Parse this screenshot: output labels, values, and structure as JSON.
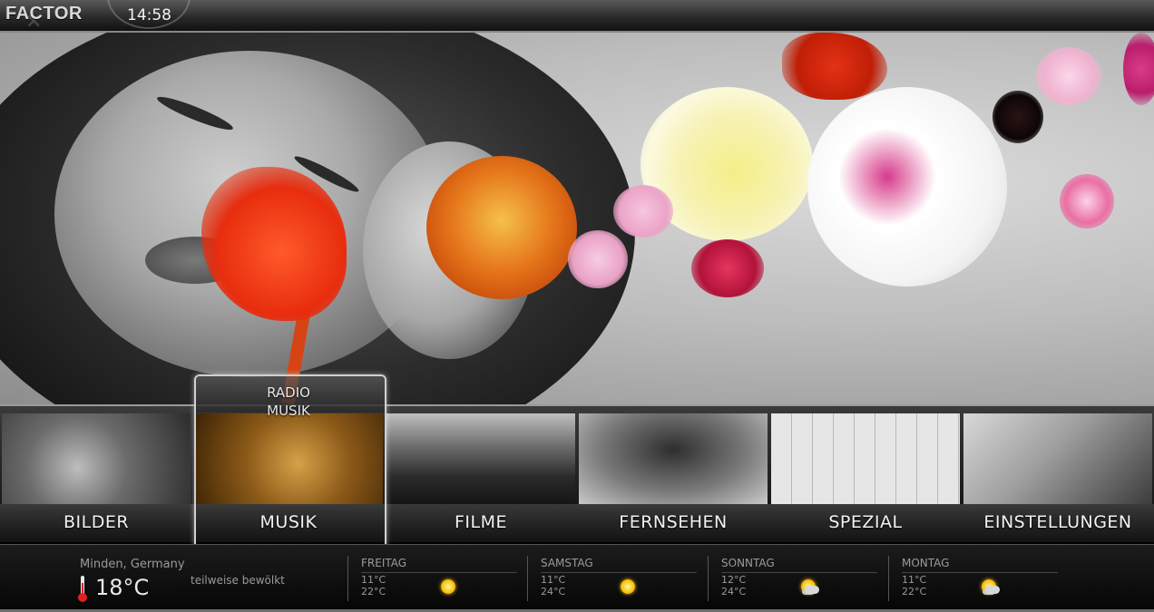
{
  "header": {
    "logo_text": "FACTOR",
    "clock": "14:58"
  },
  "menu": {
    "items": [
      {
        "label": "BILDER"
      },
      {
        "label": "MUSIK"
      },
      {
        "label": "FILME"
      },
      {
        "label": "FERNSEHEN"
      },
      {
        "label": "SPEZIAL"
      },
      {
        "label": "EINSTELLUNGEN"
      }
    ],
    "focused_index": 1,
    "submenu": [
      "RADIO",
      "MUSIK"
    ]
  },
  "weather": {
    "location": "Minden, Germany",
    "current_temp": "18°C",
    "condition": "teilweise bewölkt",
    "forecast": [
      {
        "day": "FREITAG",
        "min": "11°C",
        "max": "22°C",
        "icon": "sun-icon"
      },
      {
        "day": "SAMSTAG",
        "min": "11°C",
        "max": "24°C",
        "icon": "sun-icon"
      },
      {
        "day": "SONNTAG",
        "min": "12°C",
        "max": "24°C",
        "icon": "partly-cloudy-icon"
      },
      {
        "day": "MONTAG",
        "min": "11°C",
        "max": "22°C",
        "icon": "partly-cloudy-icon"
      }
    ]
  },
  "colors": {
    "accent": "#f7c613",
    "thermometer": "#dd2222"
  }
}
